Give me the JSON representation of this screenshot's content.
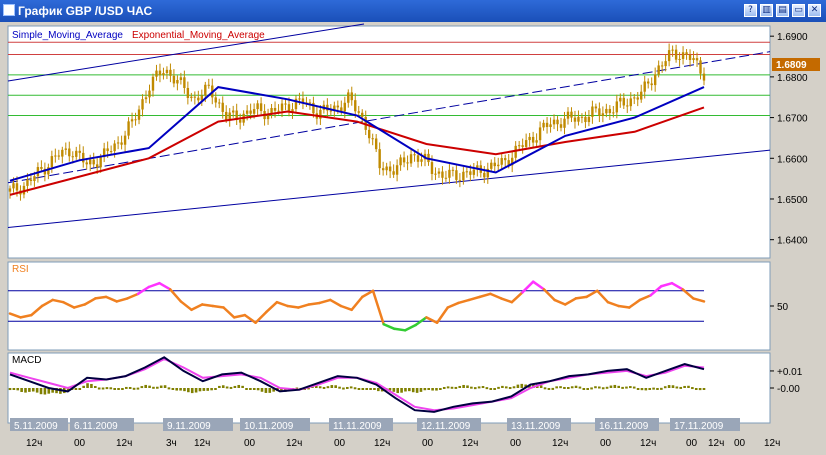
{
  "window": {
    "title": "График GBP /USD  ЧАС",
    "buttons": [
      {
        "name": "help-button",
        "glyph": "?"
      },
      {
        "name": "tile-button",
        "glyph": "▥"
      },
      {
        "name": "cascade-button",
        "glyph": "▤"
      },
      {
        "name": "minimize-button",
        "glyph": "▭"
      },
      {
        "name": "close-button",
        "glyph": "✕"
      }
    ]
  },
  "colors": {
    "panel_bg": "#ffffff",
    "border": "#7f9db9",
    "sma": "#0000c0",
    "ema": "#cc0000",
    "candle": "#c08a00",
    "rsi": "#f08020",
    "rsi_up": "#ff33ff",
    "rsi_down": "#33cc33",
    "macd_main": "#000040",
    "macd_signal": "#ee44ee",
    "histogram": "#808000",
    "h_red": "#d04040",
    "h_green": "#33bb33",
    "channel": "#0000a0",
    "date_bg": "#9aa6b8",
    "price_tag": "#c46a00"
  },
  "main_legend": {
    "sma": "Simple_Moving_Average",
    "ema": "Exponential_Moving_Average"
  },
  "current_price": "1.6809",
  "chart_data": [
    {
      "type": "line",
      "name": "price",
      "y_ticks": [
        "1.6900",
        "1.6800",
        "1.6700",
        "1.6600",
        "1.6500",
        "1.6400"
      ],
      "ylim": [
        1.6355,
        1.6925
      ],
      "x": [
        0,
        10,
        20,
        30,
        40,
        50,
        60,
        70,
        80,
        90,
        100
      ],
      "series": [
        {
          "name": "Simple_Moving_Average",
          "values": [
            1.6545,
            1.6595,
            1.6625,
            1.6775,
            1.6745,
            1.6705,
            1.66,
            1.6565,
            1.6655,
            1.67,
            1.6775
          ]
        },
        {
          "name": "Exponential_Moving_Average",
          "values": [
            1.651,
            1.6555,
            1.66,
            1.669,
            1.6715,
            1.669,
            1.6635,
            1.661,
            1.664,
            1.6665,
            1.6725
          ]
        }
      ],
      "close": [
        1.6518,
        1.6535,
        1.657,
        1.6605,
        1.6622,
        1.6583,
        1.6604,
        1.6638,
        1.669,
        1.6776,
        1.6821,
        1.6782,
        1.6745,
        1.6772,
        1.67,
        1.6705,
        1.672,
        1.6712,
        1.673,
        1.674,
        1.6712,
        1.6722,
        1.6745,
        1.669,
        1.658,
        1.657,
        1.661,
        1.659,
        1.6555,
        1.656,
        1.6565,
        1.6575,
        1.659,
        1.6625,
        1.6655,
        1.6685,
        1.6695,
        1.67,
        1.6712,
        1.672,
        1.674,
        1.676,
        1.682,
        1.686,
        1.685,
        1.6809
      ],
      "horizontal_lines": {
        "red": [
          1.6885,
          1.6855
        ],
        "green": [
          1.6805,
          1.6755,
          1.6705
        ]
      }
    },
    {
      "type": "line",
      "name": "RSI",
      "title": "RSI",
      "y_ticks": [
        "50"
      ],
      "ylim": [
        0,
        100
      ],
      "levels": [
        70,
        30
      ],
      "values": [
        40,
        35,
        38,
        50,
        58,
        55,
        48,
        52,
        60,
        62,
        56,
        60,
        66,
        75,
        80,
        72,
        56,
        45,
        52,
        50,
        48,
        35,
        38,
        28,
        42,
        55,
        50,
        48,
        52,
        54,
        58,
        50,
        45,
        62,
        70,
        26,
        20,
        18,
        25,
        35,
        28,
        48,
        54,
        58,
        62,
        66,
        60,
        55,
        68,
        82,
        72,
        58,
        52,
        60,
        62,
        70,
        55,
        50,
        48,
        58,
        64,
        76,
        80,
        72,
        60,
        56
      ]
    },
    {
      "type": "line",
      "name": "MACD",
      "title": "MACD",
      "y_ticks": [
        "+0.01",
        "-0.00"
      ],
      "ylim": [
        -0.017,
        0.017
      ],
      "series": [
        {
          "name": "macd_main",
          "values": [
            0.008,
            0.004,
            0.0,
            -0.002,
            0.006,
            0.005,
            0.007,
            0.012,
            0.018,
            0.01,
            0.004,
            0.008,
            0.009,
            0.004,
            -0.002,
            -0.001,
            0.003,
            0.007,
            0.006,
            0.002,
            -0.006,
            -0.013,
            -0.014,
            -0.011,
            -0.009,
            -0.008,
            -0.005,
            0.002,
            0.004,
            0.007,
            0.008,
            0.01,
            0.011,
            0.006,
            0.01,
            0.014,
            0.011
          ]
        },
        {
          "name": "macd_signal",
          "values": [
            0.009,
            0.006,
            0.003,
            0.0,
            0.004,
            0.005,
            0.007,
            0.011,
            0.017,
            0.012,
            0.006,
            0.007,
            0.008,
            0.006,
            0.0,
            -0.001,
            0.002,
            0.006,
            0.006,
            0.003,
            -0.004,
            -0.011,
            -0.013,
            -0.012,
            -0.01,
            -0.008,
            -0.006,
            0.0,
            0.004,
            0.006,
            0.008,
            0.009,
            0.01,
            0.007,
            0.009,
            0.013,
            0.012
          ]
        }
      ]
    }
  ],
  "time_axis": {
    "dates": [
      "5.11.2009",
      "6.11.2009",
      "9.11.2009",
      "10.11.2009",
      "11.11.2009",
      "12.11.2009",
      "13.11.2009",
      "16.11.2009",
      "17.11.2009"
    ],
    "hours": [
      "12ч",
      "00",
      "12ч",
      "3ч",
      "12ч",
      "00",
      "12ч",
      "00",
      "12ч",
      "00",
      "12ч",
      "00",
      "12ч",
      "00",
      "12ч",
      "00",
      "12ч",
      "00",
      "12ч"
    ]
  }
}
